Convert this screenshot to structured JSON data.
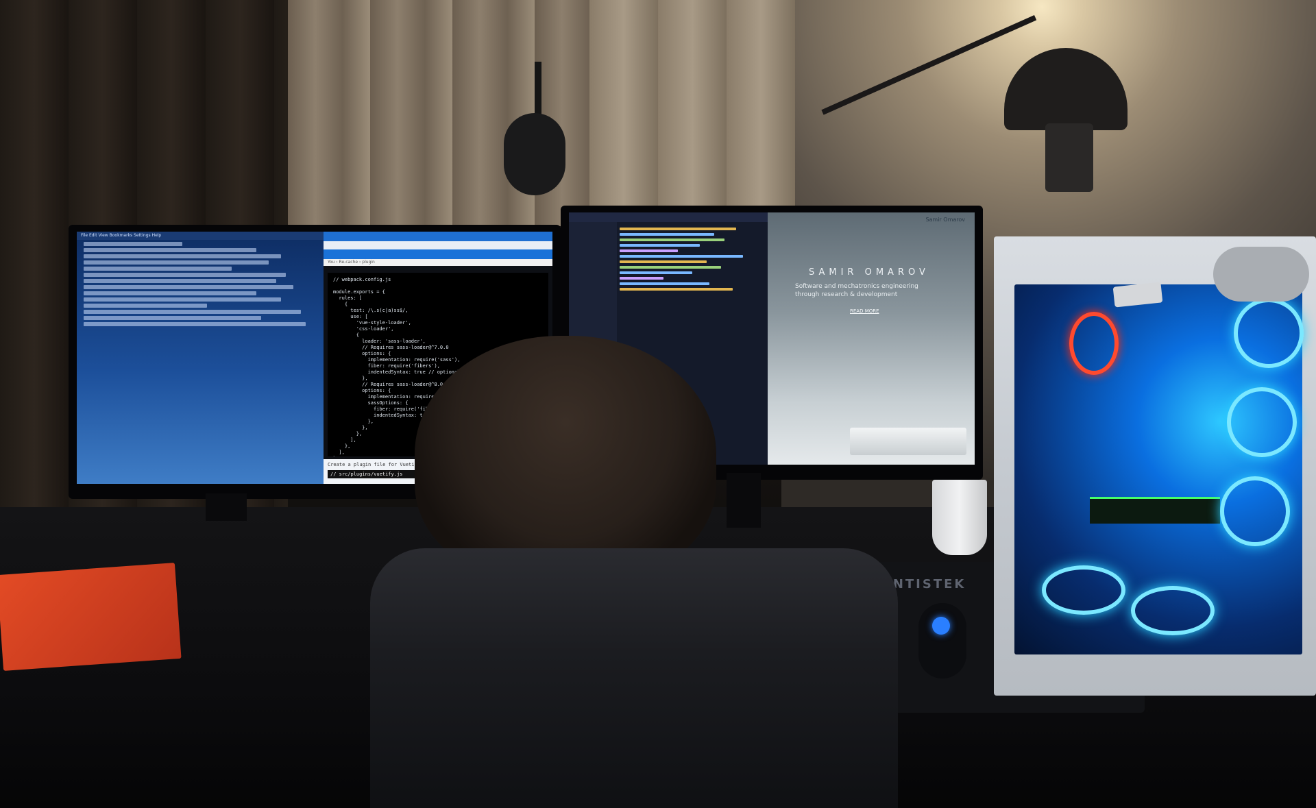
{
  "terminal": {
    "menu": "File  Edit  View  Bookmarks  Settings  Help"
  },
  "browser_left": {
    "breadcrumb": "You  ›  Re-cache  ›  plugin",
    "code_lines": [
      "// webpack.config.js",
      "",
      "module.exports = {",
      "  rules: [",
      "    {",
      "      test: /\\.s(c|a)ss$/,",
      "      use: [",
      "        'vue-style-loader',",
      "        'css-loader',",
      "        {",
      "          loader: 'sass-loader',",
      "          // Requires sass-loader@^7.0.0",
      "          options: {",
      "            implementation: require('sass'),",
      "            fiber: require('fibers'),",
      "            indentedSyntax: true // optional",
      "          },",
      "          // Requires sass-loader@^8.0.0",
      "          options: {",
      "            implementation: require('sass'),",
      "            sassOptions: {",
      "              fiber: require('fibers'),",
      "              indentedSyntax: true // optional",
      "            },",
      "          },",
      "        },",
      "      ],",
      "    },",
      "  ],",
      "}"
    ],
    "status_line_1": "Create a plugin file for Vuetify, src/plugins/vuetify.js",
    "status_line_2": "// src/plugins/vuetify.js"
  },
  "website": {
    "brand": "Samir Omarov",
    "hero_title": "SAMIR OMAROV",
    "tagline": "Software and mechatronics engineering through research & development",
    "cta": "READ MORE"
  },
  "desk": {
    "mousepad_brand": "MANTISTEK"
  },
  "colors": {
    "terminal_bg": "#1c4f9a",
    "browser_tab": "#1f6fd1",
    "pc_glow": "#2bd1ff",
    "red_fan": "#ff4a2e",
    "book": "#e34b25"
  }
}
